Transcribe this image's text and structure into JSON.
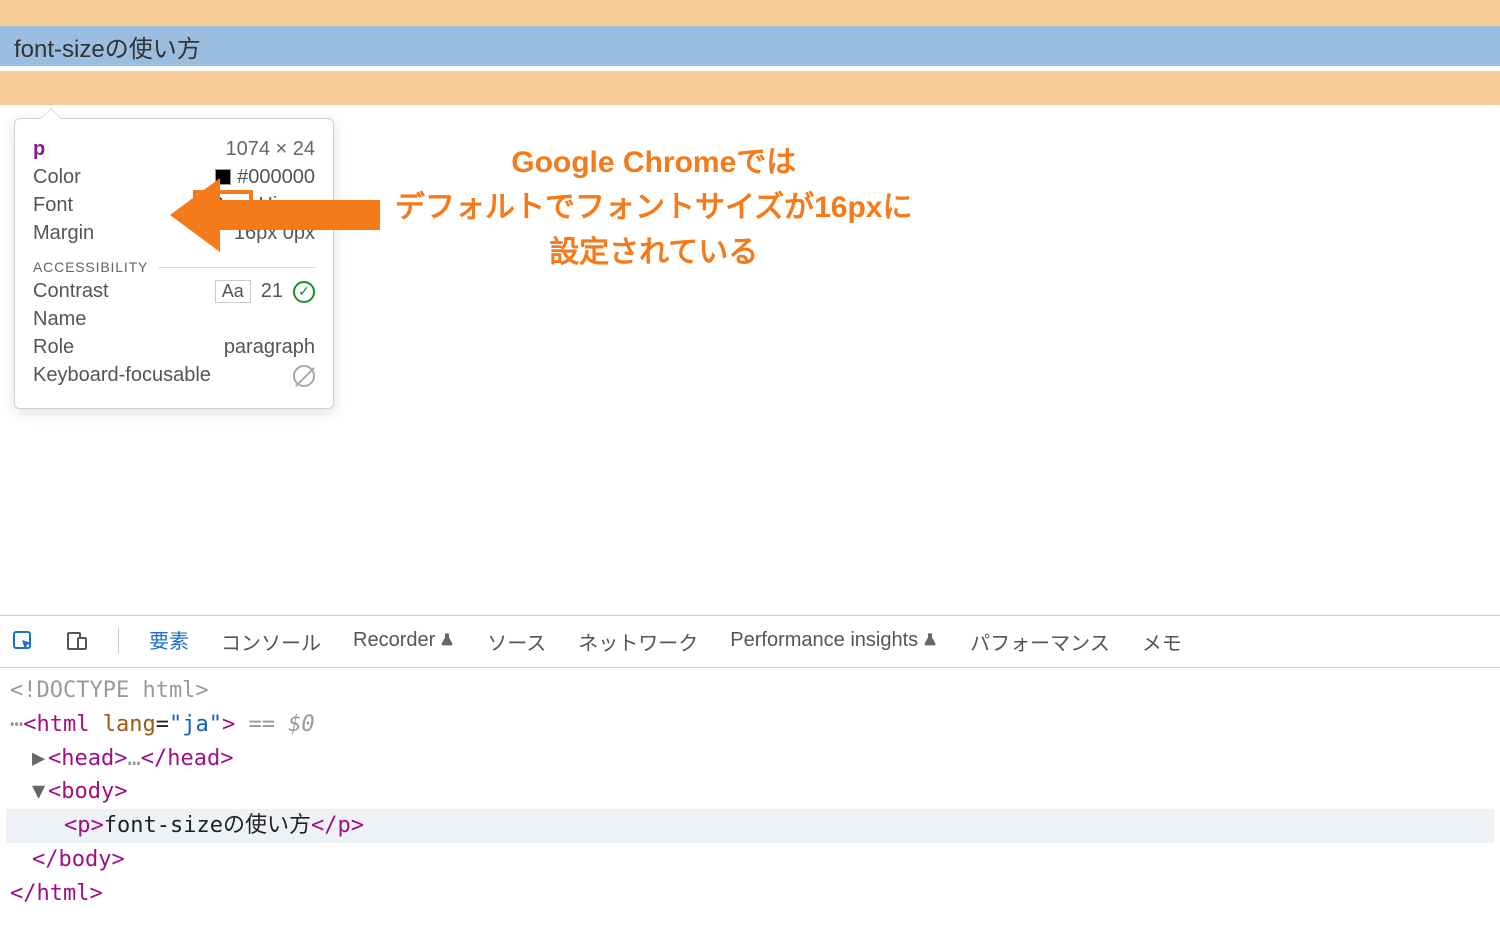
{
  "page": {
    "paragraph_text": "font-sizeの使い方"
  },
  "tooltip": {
    "tag": "p",
    "dimensions": "1074 × 24",
    "rows": {
      "color_label": "Color",
      "color_value": "#000000",
      "font_label": "Font",
      "font_size": "16px",
      "font_family": "Hira…",
      "margin_label": "Margin",
      "margin_value": "16px 0px"
    },
    "accessibility_label": "ACCESSIBILITY",
    "a11y": {
      "contrast_label": "Contrast",
      "contrast_sample": "Aa",
      "contrast_value": "21",
      "name_label": "Name",
      "role_label": "Role",
      "role_value": "paragraph",
      "kbf_label": "Keyboard-focusable"
    }
  },
  "annotation": {
    "line1": "Google Chromeでは",
    "line2": "デフォルトでフォントサイズが16pxに",
    "line3": "設定されている"
  },
  "devtools": {
    "tabs": {
      "elements": "要素",
      "console": "コンソール",
      "recorder": "Recorder",
      "sources": "ソース",
      "network": "ネットワーク",
      "perf_insights": "Performance insights",
      "performance": "パフォーマンス",
      "memory": "メモ"
    },
    "code": {
      "doctype": "<!DOCTYPE html>",
      "html_open_tag": "html",
      "html_lang_attr": "lang",
      "html_lang_val": "\"ja\"",
      "sel_hint": "== $0",
      "head_open": "<head>",
      "head_ellipsis": "…",
      "head_close": "</head>",
      "body_open": "<body>",
      "p_open": "<p>",
      "p_text": "font-sizeの使い方",
      "p_close": "</p>",
      "body_close": "</body>",
      "html_close": "</html>"
    }
  }
}
